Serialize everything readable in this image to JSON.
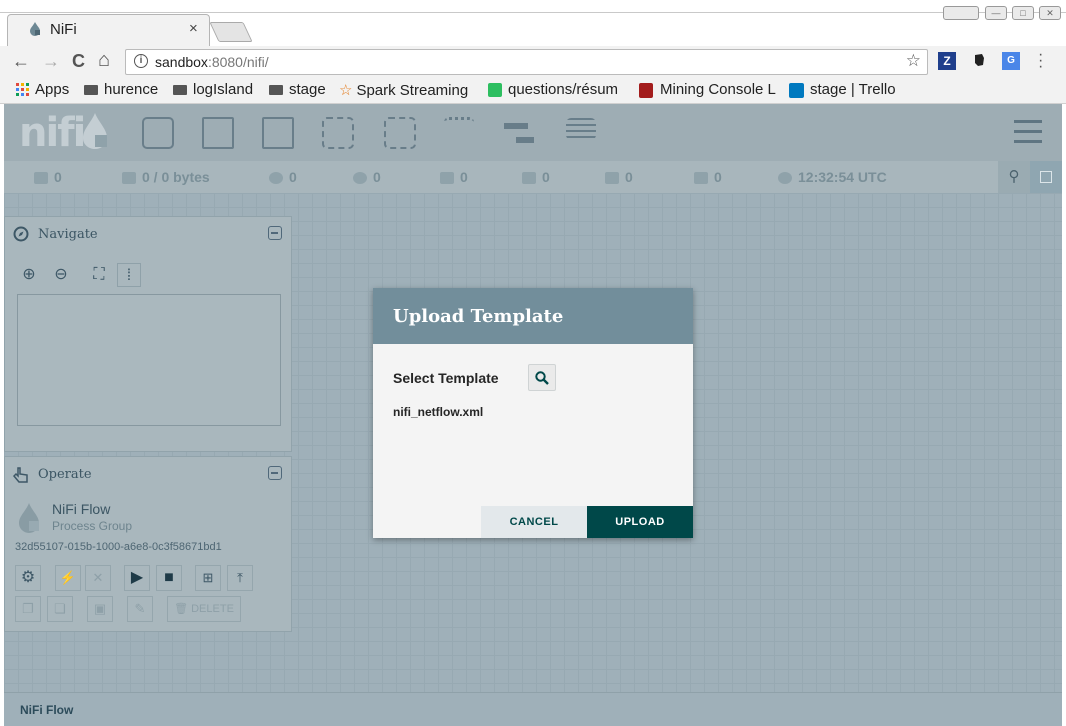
{
  "browser": {
    "tab_title": "NiFi",
    "tab_close": "×",
    "url_host": "sandbox",
    "url_rest": ":8080/nifi/",
    "nav_back": "←",
    "nav_forward": "→",
    "nav_reload": "C",
    "nav_home": "⌂",
    "bookmark_star": "☆",
    "window_min": "—",
    "window_max": "□",
    "window_close": "✕",
    "bookmarks": [
      {
        "label": "Apps"
      },
      {
        "label": "hurence"
      },
      {
        "label": "logIsland"
      },
      {
        "label": "stage"
      },
      {
        "label": "Spark Streaming"
      },
      {
        "label": "questions/résum"
      },
      {
        "label": "Mining Console L"
      },
      {
        "label": "stage | Trello"
      }
    ]
  },
  "nifi": {
    "logo": "nifi",
    "status": {
      "threads": "0",
      "queued": "0 / 0 bytes",
      "transmitting": "0",
      "not_transmitting": "0",
      "running": "0",
      "stopped": "0",
      "invalid": "0",
      "disabled": "0",
      "last_refresh": "12:32:54 UTC"
    },
    "navigate": {
      "title": "Navigate"
    },
    "operate": {
      "title": "Operate",
      "component_name": "NiFi Flow",
      "component_type": "Process Group",
      "component_id": "32d55107-015b-1000-a6e8-0c3f58671bd1",
      "delete_label": "DELETE"
    },
    "breadcrumb": "NiFi Flow"
  },
  "dialog": {
    "title": "Upload Template",
    "select_label": "Select Template",
    "file_name": "nifi_netflow.xml",
    "cancel_label": "CANCEL",
    "upload_label": "UPLOAD"
  },
  "colors": {
    "accent": "#004849",
    "dialog_header": "#728e9b",
    "canvas": "#9fb0b9"
  }
}
